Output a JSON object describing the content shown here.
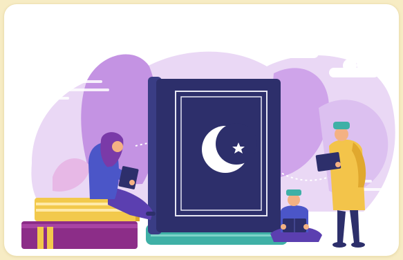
{
  "illustration": {
    "icon": "crescent-star-icon",
    "colors": {
      "page_background": "#f7ecc4",
      "card_background": "#ffffff",
      "blob_light": "#ead8f5",
      "blob_mid": "#d6b0ec",
      "blob_dark": "#b988de",
      "book_cover": "#2d2f6b",
      "book_spine": "#3a3d85",
      "book_pages": "#3fb0a6",
      "crescent": "#ffffff",
      "yellow_book": "#f2c94c",
      "purple_book": "#8c2d88",
      "skin": "#f4b183",
      "robe_yellow": "#f3c44a",
      "hijab_purple": "#7a3aa8"
    }
  }
}
